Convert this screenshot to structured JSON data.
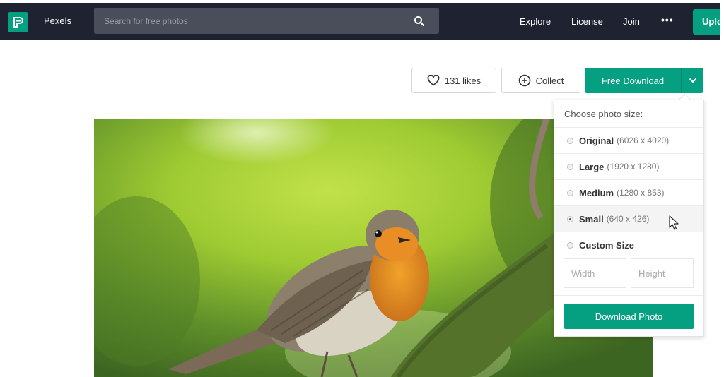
{
  "header": {
    "brand": "Pexels",
    "search_placeholder": "Search for free photos",
    "nav": [
      "Explore",
      "License",
      "Join"
    ],
    "more": "•••",
    "upload_label": "Upload"
  },
  "actions": {
    "likes_label": "131 likes",
    "collect_label": "Collect",
    "free_download_label": "Free Download"
  },
  "size_menu": {
    "title": "Choose photo size:",
    "options": [
      {
        "name": "Original",
        "dims": "(6026 x 4020)",
        "selected": false
      },
      {
        "name": "Large",
        "dims": "(1920 x 1280)",
        "selected": false
      },
      {
        "name": "Medium",
        "dims": "(1280 x 853)",
        "selected": false
      },
      {
        "name": "Small",
        "dims": "(640 x 426)",
        "selected": true
      },
      {
        "name": "Custom Size",
        "dims": "",
        "selected": false
      }
    ],
    "width_placeholder": "Width",
    "height_placeholder": "Height",
    "download_label": "Download Photo"
  },
  "colors": {
    "topbar": "#1f2331",
    "accent": "#05a081",
    "search_bg": "#4a4e5b"
  },
  "icons": [
    "pexels-logo-icon",
    "search-icon",
    "heart-icon",
    "plus-circle-icon",
    "chevron-down-icon",
    "cursor-icon"
  ]
}
